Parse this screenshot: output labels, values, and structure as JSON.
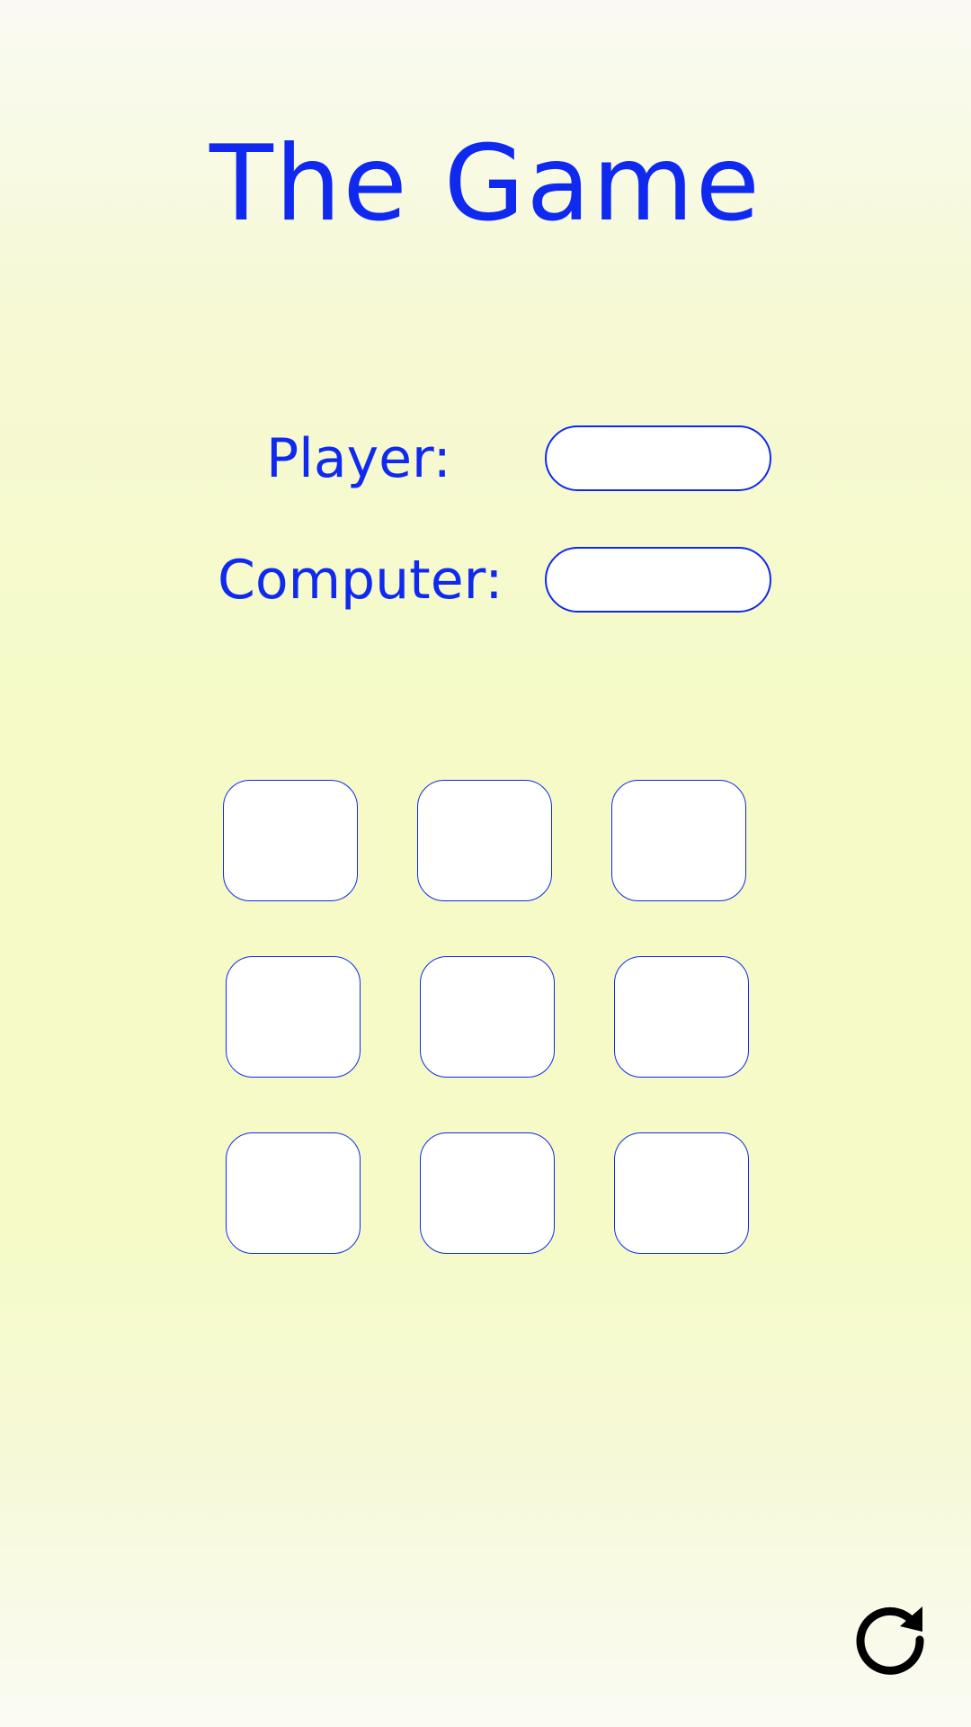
{
  "title": "The Game",
  "scores": {
    "player_label": "Player:",
    "player_value": "",
    "computer_label": "Computer:",
    "computer_value": ""
  },
  "board": {
    "cells": [
      "",
      "",
      "",
      "",
      "",
      "",
      "",
      "",
      ""
    ]
  },
  "controls": {
    "reset_icon": "refresh-icon"
  },
  "colors": {
    "accent": "#1029ee",
    "background": "#f5fac6",
    "cell_fill": "#ffffff",
    "icon": "#000000"
  }
}
